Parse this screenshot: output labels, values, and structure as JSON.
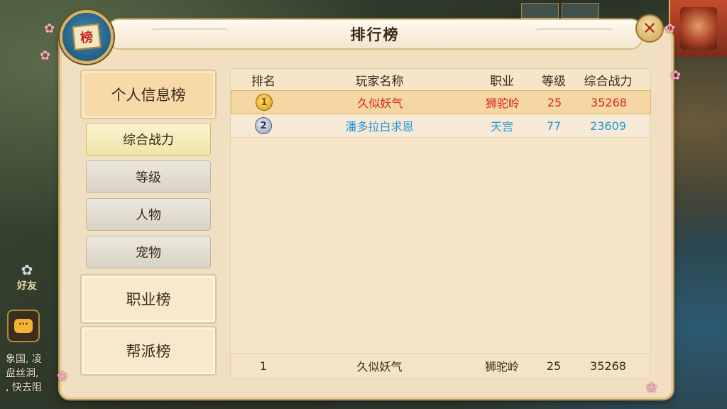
{
  "window": {
    "title": "排行榜"
  },
  "badge": {
    "glyph": "榜"
  },
  "close": {
    "glyph": "✕"
  },
  "categories": [
    {
      "label": "个人信息榜",
      "active": true
    },
    {
      "label": "职业榜",
      "active": false
    },
    {
      "label": "帮派榜",
      "active": false
    }
  ],
  "subtabs": [
    {
      "label": "综合战力",
      "active": true
    },
    {
      "label": "等级",
      "active": false
    },
    {
      "label": "人物",
      "active": false
    },
    {
      "label": "宠物",
      "active": false
    }
  ],
  "table": {
    "headers": [
      "排名",
      "玩家名称",
      "职业",
      "等级",
      "综合战力"
    ],
    "rows": [
      {
        "rank": "1",
        "medal": "gold-medal",
        "name": "久似妖气",
        "job": "狮驼岭",
        "level": "25",
        "power": "35268",
        "color": "#d9231b"
      },
      {
        "rank": "2",
        "medal": "silver-medal",
        "name": "潘多拉白求恩",
        "job": "天宫",
        "level": "77",
        "power": "23609",
        "color": "#2496d6"
      }
    ],
    "mine": {
      "rank": "1",
      "name": "久似妖气",
      "job": "狮驼岭",
      "level": "25",
      "power": "35268"
    }
  },
  "hud": {
    "friend_label": "好友",
    "chat_glyph": "···",
    "chat_lines": [
      "象国, 凌",
      "盘丝洞,",
      ", 快去阻"
    ]
  }
}
